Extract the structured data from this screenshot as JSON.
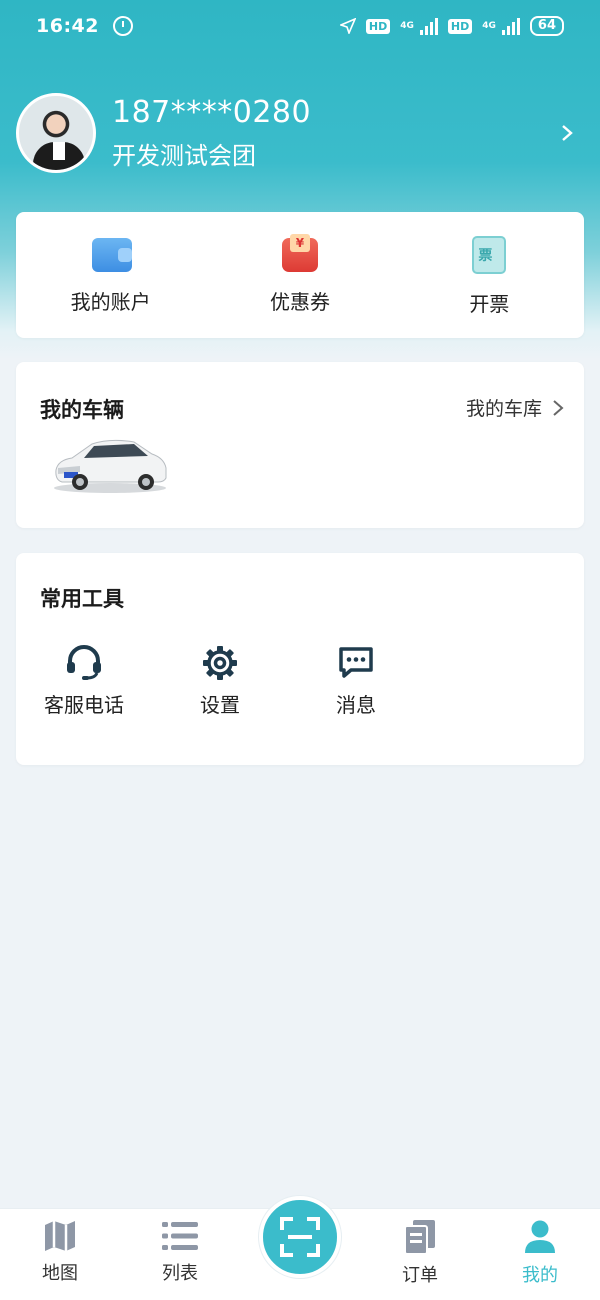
{
  "status_bar": {
    "time": "16:42",
    "hd_label": "HD",
    "network_label": "4G",
    "battery": "64"
  },
  "profile": {
    "phone": "187****0280",
    "group": "开发测试会团"
  },
  "shortcuts": [
    {
      "label": "我的账户",
      "icon": "wallet-icon"
    },
    {
      "label": "优惠券",
      "icon": "coupon-icon"
    },
    {
      "label": "开票",
      "icon": "invoice-icon"
    }
  ],
  "vehicles": {
    "title": "我的车辆",
    "garage_link": "我的车库"
  },
  "tools": {
    "title": "常用工具",
    "items": [
      {
        "label": "客服电话",
        "icon": "headset-icon"
      },
      {
        "label": "设置",
        "icon": "gear-icon"
      },
      {
        "label": "消息",
        "icon": "message-icon"
      }
    ]
  },
  "tabbar": {
    "items": [
      {
        "label": "地图",
        "icon": "map-icon"
      },
      {
        "label": "列表",
        "icon": "list-icon"
      },
      {
        "label": "订单",
        "icon": "order-icon"
      },
      {
        "label": "我的",
        "icon": "user-icon",
        "active": true
      }
    ],
    "scan_icon": "scan-icon"
  },
  "colors": {
    "accent": "#3bbccb",
    "icon_dark": "#1f3b4d",
    "tab_icon": "#8e97a6"
  }
}
